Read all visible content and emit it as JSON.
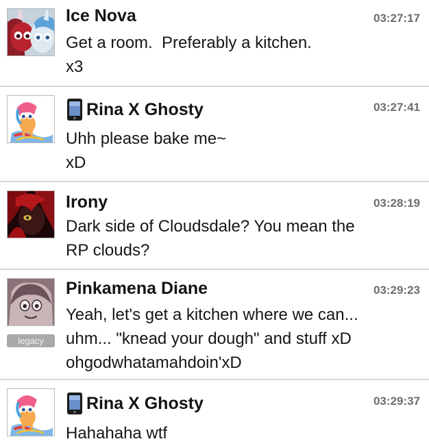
{
  "messages": [
    {
      "name": "Ice Nova",
      "mobile": false,
      "time": "03:27:17",
      "text": "Get a room.  Preferably a kitchen.\nx3",
      "avatar": "ice-nova-avatar"
    },
    {
      "name": "Rina X Ghosty",
      "mobile": true,
      "time": "03:27:41",
      "text": "Uhh please bake me~\nxD",
      "avatar": "rina-avatar"
    },
    {
      "name": "Irony",
      "mobile": false,
      "time": "03:28:19",
      "text": "Dark side of Cloudsdale? You mean the\nRP clouds?",
      "avatar": "irony-avatar"
    },
    {
      "name": "Pinkamena Diane",
      "mobile": false,
      "time": "03:29:23",
      "text": "Yeah, let's get a kitchen where we can...\nuhm... \"knead your dough\" and stuff xD\nohgodwhatamahdoin'xD",
      "avatar": "pinkamena-avatar",
      "badge": "legacy"
    },
    {
      "name": "Rina X Ghosty",
      "mobile": true,
      "time": "03:29:37",
      "text": "Hahahaha wtf",
      "avatar": "rina-avatar"
    }
  ],
  "colors": {
    "divider": "#d6d6d6",
    "timestamp": "#6e6e6e",
    "badge_bg": "#a9a9a9"
  }
}
